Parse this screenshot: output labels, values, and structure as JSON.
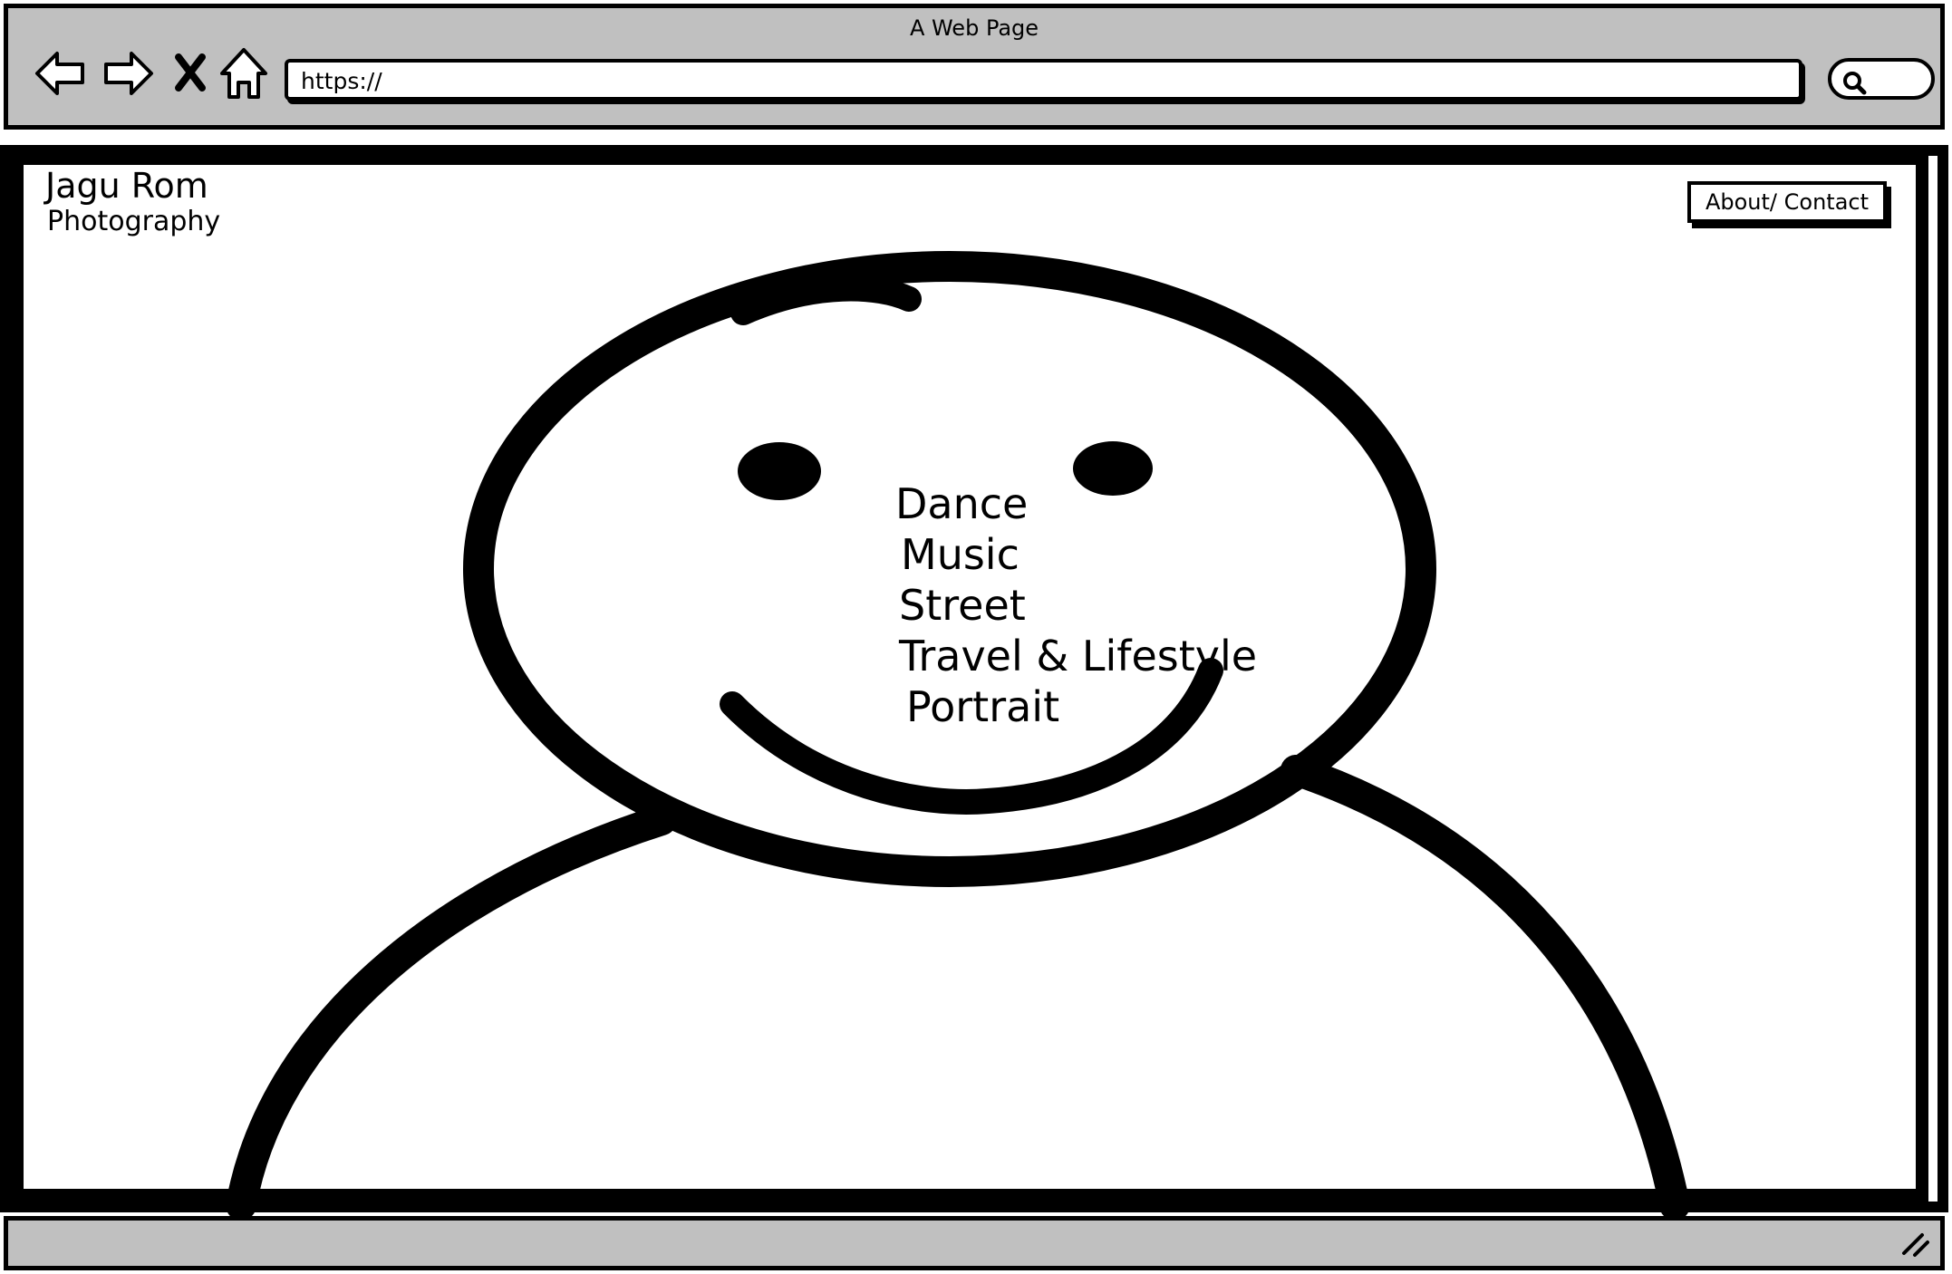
{
  "window": {
    "title": "A Web Page"
  },
  "toolbar": {
    "icons": [
      "back-arrow-icon",
      "forward-arrow-icon",
      "stop-icon",
      "home-icon",
      "search-icon"
    ],
    "url": "https://"
  },
  "site": {
    "brand_name": "Jagu Rom",
    "brand_sub": "Photography",
    "about_label": "About/ Contact"
  },
  "menu": {
    "items": [
      {
        "label": "Dance"
      },
      {
        "label": "Music"
      },
      {
        "label": "Street"
      },
      {
        "label": "Travel & Lifestyle"
      },
      {
        "label": "Portrait"
      }
    ]
  },
  "colors": {
    "chrome": "#c0c0c0",
    "ink": "#000000",
    "page": "#ffffff"
  }
}
